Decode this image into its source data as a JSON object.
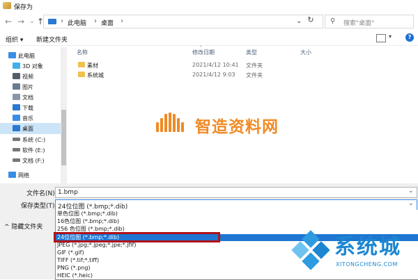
{
  "window": {
    "title": "保存为"
  },
  "address": {
    "crumbs": [
      "此电脑",
      "桌面"
    ],
    "separator": "›"
  },
  "search": {
    "placeholder": "搜索\"桌面\""
  },
  "toolbar": {
    "organize": "组织 ▾",
    "new_folder": "新建文件夹"
  },
  "sidebar": {
    "items": [
      {
        "label": "此电脑",
        "icon": "pc-icon",
        "color": "#3a8ee6"
      },
      {
        "label": "3D 对象",
        "icon": "3d-objects-icon",
        "color": "#3fb0e8"
      },
      {
        "label": "视频",
        "icon": "video-icon",
        "color": "#555d6b"
      },
      {
        "label": "图片",
        "icon": "pictures-icon",
        "color": "#6a7a90"
      },
      {
        "label": "文档",
        "icon": "documents-icon",
        "color": "#8a96a8"
      },
      {
        "label": "下载",
        "icon": "download-icon",
        "color": "#2b79d0"
      },
      {
        "label": "音乐",
        "icon": "music-icon",
        "color": "#3a8ee6"
      },
      {
        "label": "桌面",
        "icon": "desktop-icon",
        "color": "#2b79d0",
        "selected": true
      },
      {
        "label": "系统 (C:)",
        "icon": "drive-c-icon",
        "color": "#777777"
      },
      {
        "label": "软件 (E:)",
        "icon": "drive-e-icon",
        "color": "#777777"
      },
      {
        "label": "文档 (F:)",
        "icon": "drive-f-icon",
        "color": "#777777"
      },
      {
        "label": "网络",
        "icon": "network-icon",
        "color": "#3a8ee6"
      }
    ]
  },
  "filelist": {
    "columns": [
      "名称",
      "修改日期",
      "类型",
      "大小"
    ],
    "rows": [
      {
        "name": "素材",
        "modified": "2021/4/12 10:41",
        "type": "文件夹"
      },
      {
        "name": "系统城",
        "modified": "2021/4/12 9:03",
        "type": "文件夹"
      }
    ]
  },
  "watermark_center": {
    "text": "智造资料网",
    "color": "#f08a24"
  },
  "form": {
    "filename_label": "文件名(N):",
    "filename_value": "1.bmp",
    "filetype_label": "保存类型(T):",
    "filetype_value": "24位位图 (*.bmp;*.dib)",
    "hide_folders": "隐藏文件夹"
  },
  "filetype_options": [
    "单色位图 (*.bmp;*.dib)",
    "16色位图 (*.bmp;*.dib)",
    "256 色位图 (*.bmp;*.dib)",
    "24位位图 (*.bmp;*.dib)",
    "JPEG (*.jpg;*.jpeg;*.jpe;*.jfif)",
    "GIF (*.gif)",
    "TIFF (*.tif;*.tiff)",
    "PNG (*.png)",
    "HEIC (*.heic)"
  ],
  "selected_option_index": 3,
  "watermark_corner": {
    "cn": "系统城",
    "en": "XITONGCHENG.COM",
    "color": "#1c86d1"
  }
}
